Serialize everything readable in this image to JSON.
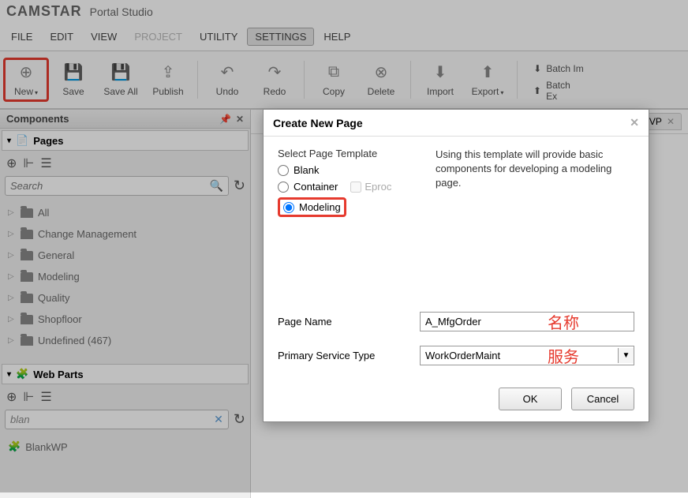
{
  "brand": "CAMSTAR",
  "brand_sub": "Portal Studio",
  "menubar": [
    "FILE",
    "EDIT",
    "VIEW",
    "PROJECT",
    "UTILITY",
    "SETTINGS",
    "HELP"
  ],
  "menubar_disabled_index": 3,
  "menubar_active_index": 5,
  "toolbar": {
    "new": "New",
    "save": "Save",
    "save_all": "Save All",
    "publish": "Publish",
    "undo": "Undo",
    "redo": "Redo",
    "copy": "Copy",
    "delete": "Delete",
    "import": "Import",
    "export": "Export",
    "batch_im": "Batch Im",
    "batch_ex": "Batch Ex"
  },
  "sidebar": {
    "title": "Components",
    "pages": {
      "title": "Pages",
      "search_placeholder": "Search",
      "items": [
        "All",
        "Change Management",
        "General",
        "Modeling",
        "Quality",
        "Shopfloor",
        "Undefined (467)"
      ]
    },
    "webparts": {
      "title": "Web Parts",
      "search_value": "blan",
      "result": "BlankWP"
    }
  },
  "tab": {
    "label": "VP"
  },
  "dialog": {
    "title": "Create New Page",
    "section_label": "Select Page Template",
    "radios": {
      "blank": "Blank",
      "container": "Container",
      "modeling": "Modeling"
    },
    "eproc": "Eproc",
    "description": "Using this template will provide basic components for developing a modeling page.",
    "page_name_label": "Page Name",
    "page_name_value": "A_MfgOrder",
    "service_label": "Primary Service Type",
    "service_value": "WorkOrderMaint",
    "ann_name": "名称",
    "ann_service": "服务",
    "ok": "OK",
    "cancel": "Cancel"
  }
}
